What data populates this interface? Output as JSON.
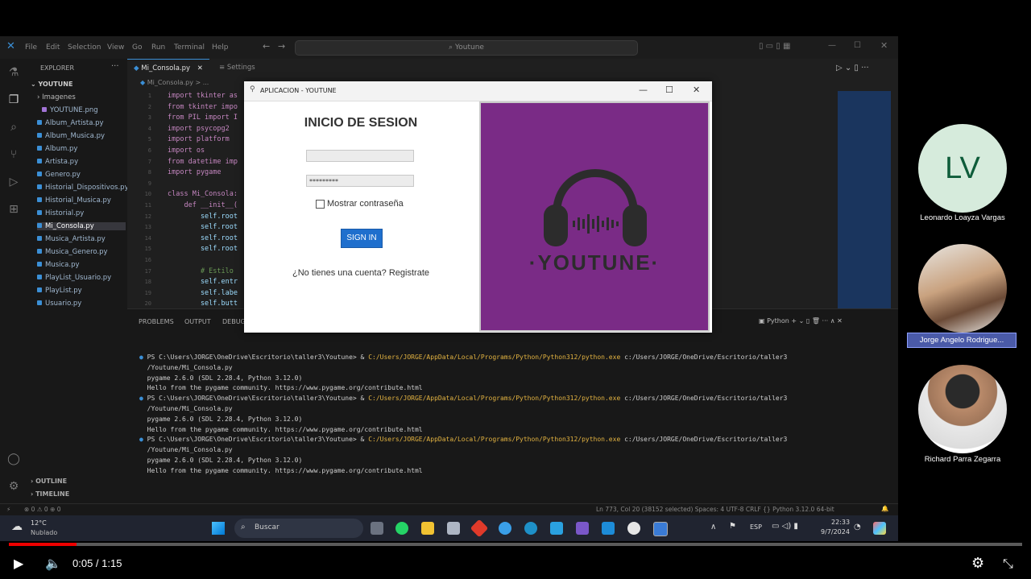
{
  "vscode": {
    "menu": [
      "File",
      "Edit",
      "Selection",
      "View",
      "Go",
      "Run",
      "Terminal",
      "Help"
    ],
    "search_text": "Youtune",
    "explorer_label": "EXPLORER",
    "project_name": "YOUTUNE",
    "folder_imagenes": "Imagenes",
    "files": [
      "YOUTUNE.png",
      "Album_Artista.py",
      "Album_Musica.py",
      "Album.py",
      "Artista.py",
      "Genero.py",
      "Historial_Dispositivos.py",
      "Historial_Musica.py",
      "Historial.py",
      "Mi_Consola.py",
      "Musica_Artista.py",
      "Musica_Genero.py",
      "Musica.py",
      "PlayList_Usuario.py",
      "PlayList.py",
      "Usuario.py"
    ],
    "active_file": "Mi_Consola.py",
    "outline_label": "OUTLINE",
    "timeline_label": "TIMELINE",
    "tabs": [
      "Mi_Consola.py",
      "Settings"
    ],
    "breadcrumb": "Mi_Consola.py > ...",
    "code_lines": [
      {
        "n": "1",
        "t": "import tkinter as"
      },
      {
        "n": "2",
        "t": "from tkinter impo"
      },
      {
        "n": "3",
        "t": "from PIL import I"
      },
      {
        "n": "4",
        "t": "import psycopg2"
      },
      {
        "n": "5",
        "t": "import platform"
      },
      {
        "n": "6",
        "t": "import os"
      },
      {
        "n": "7",
        "t": "from datetime imp"
      },
      {
        "n": "8",
        "t": "import pygame"
      },
      {
        "n": "9",
        "t": ""
      },
      {
        "n": "10",
        "t": "class Mi_Consola:"
      },
      {
        "n": "11",
        "t": "    def __init__("
      },
      {
        "n": "12",
        "t": "        self.root"
      },
      {
        "n": "13",
        "t": "        self.root"
      },
      {
        "n": "14",
        "t": "        self.root"
      },
      {
        "n": "15",
        "t": "        self.root"
      },
      {
        "n": "16",
        "t": ""
      },
      {
        "n": "17",
        "t": "        # Estilo"
      },
      {
        "n": "18",
        "t": "        self.entr"
      },
      {
        "n": "19",
        "t": "        self.labe"
      },
      {
        "n": "20",
        "t": "        self.butt"
      }
    ],
    "panel_tabs": [
      "PROBLEMS",
      "OUTPUT",
      "DEBUG"
    ],
    "panel_right_label": "Python",
    "terminal": [
      {
        "prompt": "PS C:\\Users\\JORGE\\OneDrive\\Escritorio\\taller3\\Youtune> & ",
        "cmd": "C:/Users/JORGE/AppData/Local/Programs/Python/Python312/python.exe",
        "rest": " c:/Users/JORGE/OneDrive/Escritorio/taller3"
      },
      {
        "prompt": "/Youtune/Mi_Consola.py",
        "cmd": "",
        "rest": ""
      },
      {
        "prompt": "pygame 2.6.0 (SDL 2.28.4, Python 3.12.0)",
        "cmd": "",
        "rest": ""
      },
      {
        "prompt": "Hello from the pygame community. https://www.pygame.org/contribute.html",
        "cmd": "",
        "rest": ""
      },
      {
        "prompt": "PS C:\\Users\\JORGE\\OneDrive\\Escritorio\\taller3\\Youtune> & ",
        "cmd": "C:/Users/JORGE/AppData/Local/Programs/Python/Python312/python.exe",
        "rest": " c:/Users/JORGE/OneDrive/Escritorio/taller3"
      },
      {
        "prompt": "/Youtune/Mi_Consola.py",
        "cmd": "",
        "rest": ""
      },
      {
        "prompt": "pygame 2.6.0 (SDL 2.28.4, Python 3.12.0)",
        "cmd": "",
        "rest": ""
      },
      {
        "prompt": "Hello from the pygame community. https://www.pygame.org/contribute.html",
        "cmd": "",
        "rest": ""
      },
      {
        "prompt": "PS C:\\Users\\JORGE\\OneDrive\\Escritorio\\taller3\\Youtune> & ",
        "cmd": "C:/Users/JORGE/AppData/Local/Programs/Python/Python312/python.exe",
        "rest": " c:/Users/JORGE/OneDrive/Escritorio/taller3"
      },
      {
        "prompt": "/Youtune/Mi_Consola.py",
        "cmd": "",
        "rest": ""
      },
      {
        "prompt": "pygame 2.6.0 (SDL 2.28.4, Python 3.12.0)",
        "cmd": "",
        "rest": ""
      },
      {
        "prompt": "Hello from the pygame community. https://www.pygame.org/contribute.html",
        "cmd": "",
        "rest": ""
      }
    ],
    "status_left": "⊗ 0 ⚠ 0   ⊕ 0",
    "status_right": "Ln 773, Col 20 (38152 selected)   Spaces: 4   UTF-8   CRLF   {} Python   3.12.0 64-bit"
  },
  "app": {
    "window_title": "APLICACION - YOUTUNE",
    "login_title": "INICIO DE SESION",
    "username_value": "",
    "password_value": "*********",
    "show_password_label": "Mostrar contraseña",
    "signin_label": "SIGN IN",
    "register_text": "¿No tienes una cuenta? Registrate",
    "brand_name": "·YOUTUNE·",
    "brand_color": "#7a2b86"
  },
  "participants": [
    {
      "initials": "LV",
      "name": "Leonardo Loayza Vargas"
    },
    {
      "initials": "",
      "name": "Jorge Angelo  Rodrigue..."
    },
    {
      "initials": "",
      "name": "Richard   Parra Zegarra"
    }
  ],
  "taskbar": {
    "weather_temp": "12°C",
    "weather_desc": "Nublado",
    "search_label": "Buscar",
    "lang": "ESP",
    "time": "22:33",
    "date": "9/7/2024"
  },
  "video": {
    "timecode": "0:05 / 1:15",
    "progress": 0.067
  }
}
